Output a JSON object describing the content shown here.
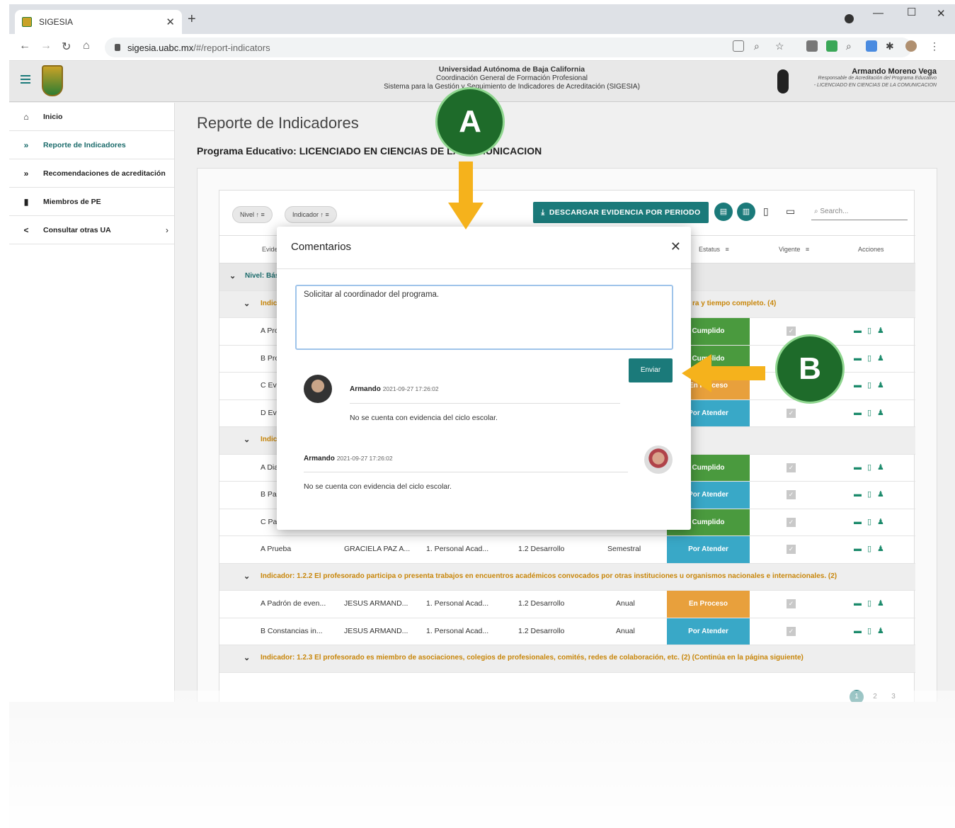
{
  "browser": {
    "tab_title": "SIGESIA",
    "url_host": "sigesia.uabc.mx",
    "url_path": "/#/report-indicators"
  },
  "header": {
    "line1": "Universidad Autónoma de Baja California",
    "line2": "Coordinación General de Formación Profesional",
    "line3": "Sistema para la Gestión y Seguimiento de Indicadores de Acreditación (SIGESIA)",
    "user_name": "Armando Moreno Vega",
    "user_role1": "Responsable de Acreditación del Programa Educativo",
    "user_role2": "- LICENCIADO EN CIENCIAS DE LA COMUNICACION"
  },
  "sidebar": {
    "items": [
      {
        "label": "Inicio",
        "icon": "home-icon"
      },
      {
        "label": "Reporte de Indicadores",
        "icon": "double-chevron-icon"
      },
      {
        "label": "Recomendaciones de acreditación",
        "icon": "double-chevron-icon"
      },
      {
        "label": "Miembros de PE",
        "icon": "bookmark-icon"
      },
      {
        "label": "Consultar otras UA",
        "icon": "share-icon"
      }
    ]
  },
  "main": {
    "title": "Reporte de Indicadores",
    "subtitle": "Programa Educativo: LICENCIADO EN CIENCIAS DE LA COMUNICACION",
    "chip_nivel": "Nivel",
    "chip_indicador": "Indicador",
    "download_label": "DESCARGAR EVIDENCIA POR PERIODO",
    "search_placeholder": "Search...",
    "headers": {
      "evidencia": "Evidencia",
      "estatus": "Estatus",
      "vigente": "Vigente",
      "acciones": "Acciones"
    },
    "nivel_label": "Nivel: Básico",
    "indicador_1_1_tail": "ra y tiempo completo. (4)",
    "rows_a": [
      {
        "ev": "A Pro",
        "status": "Cumplido"
      },
      {
        "ev": "B Pro",
        "status": "Cumplido"
      },
      {
        "ev": "C Evi",
        "status": "En Proceso"
      },
      {
        "ev": "D Evi",
        "status": "Por Atender"
      }
    ],
    "indicador_short": "Indic",
    "rows_b": [
      {
        "ev": "A Dia",
        "status": "Cumplido"
      },
      {
        "ev": "B Pa",
        "status": "Por Atender"
      },
      {
        "ev": "C Pa",
        "status": "Cumplido"
      }
    ],
    "row_prueba": {
      "ev": "A Prueba",
      "resp": "GRACIELA PAZ A...",
      "cat": "1. Personal Acad...",
      "sub": "1.2 Desarrollo",
      "per": "Semestral",
      "status": "Por Atender"
    },
    "indicador_1_2_2": "Indicador: 1.2.2 El profesorado participa o presenta trabajos en encuentros académicos convocados por otras instituciones u organismos nacionales e internacionales. (2)",
    "rows_c": [
      {
        "ev": "A Padrón de even...",
        "resp": "JESUS ARMAND...",
        "cat": "1. Personal Acad...",
        "sub": "1.2 Desarrollo",
        "per": "Anual",
        "status": "En Proceso"
      },
      {
        "ev": "B Constancias in...",
        "resp": "JESUS ARMAND...",
        "cat": "1. Personal Acad...",
        "sub": "1.2 Desarrollo",
        "per": "Anual",
        "status": "Por Atender"
      }
    ],
    "indicador_1_2_3": "Indicador: 1.2.3 El profesorado es miembro de asociaciones, colegios de profesionales, comités, redes de colaboración, etc. (2) (Continúa en la página siguiente)",
    "pages": [
      "1",
      "2",
      "3"
    ]
  },
  "modal": {
    "title": "Comentarios",
    "textarea_value": "Solicitar al coordinador del programa.",
    "send_label": "Enviar",
    "comments": [
      {
        "author": "Armando",
        "date": "2021-09-27 17:26:02",
        "text": "No se cuenta con evidencia del ciclo escolar."
      },
      {
        "author": "Armando",
        "date": "2021-09-27 17:26:02",
        "text": "No se cuenta con evidencia del ciclo escolar."
      }
    ]
  },
  "annotations": {
    "a": "A",
    "b": "B"
  },
  "colors": {
    "teal": "#1b7a7a",
    "cumplido": "#4a9a3e",
    "proceso": "#e8a03c",
    "atender": "#39a8c7",
    "badge": "#1e6b2a",
    "arrow": "#f5b21c"
  }
}
